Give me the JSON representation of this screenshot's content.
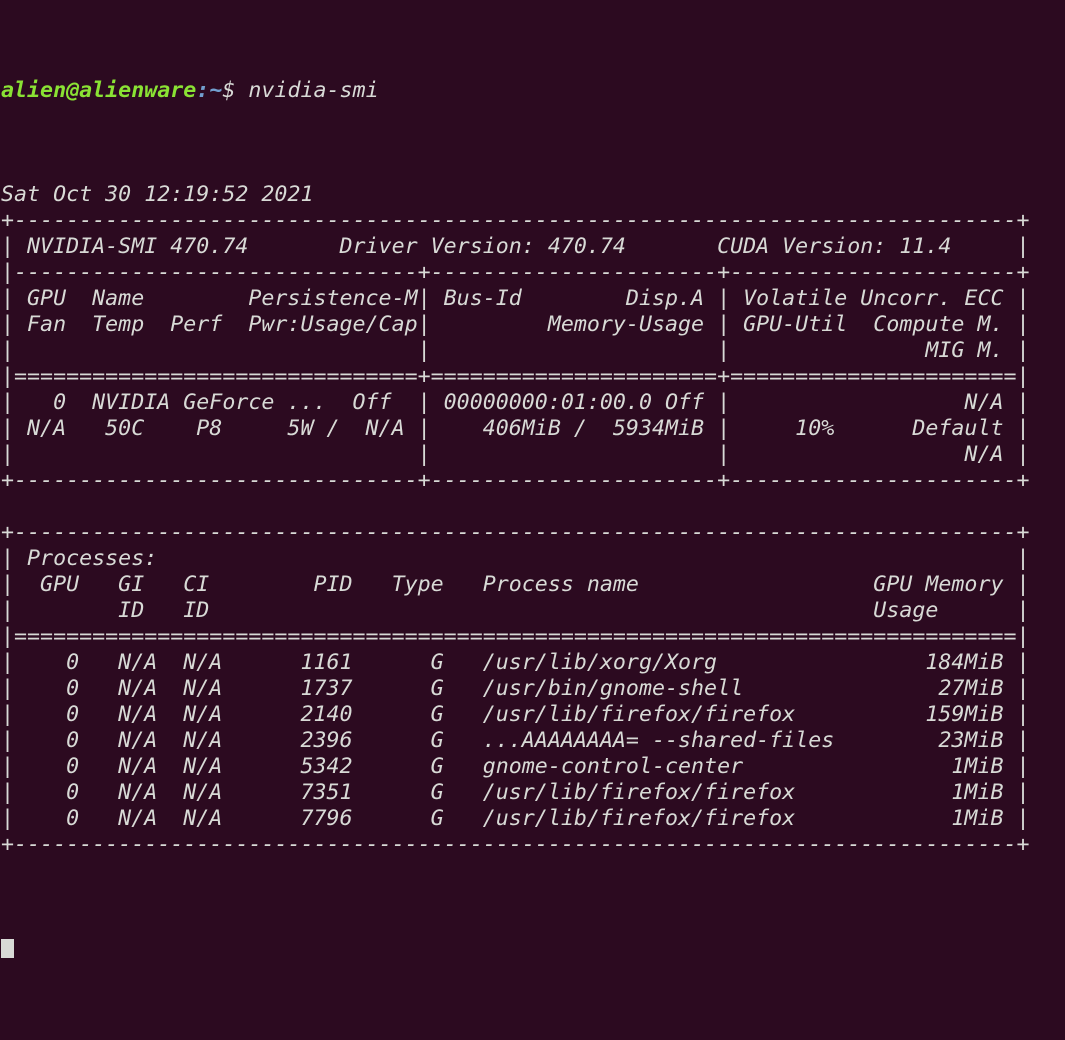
{
  "terminal": {
    "window_title": "alien@alienware: ~",
    "colors": {
      "background": "#2c0a20",
      "foreground": "#d8dad6",
      "prompt_user": "#8ae234",
      "prompt_path": "#729fcf"
    },
    "prompt": {
      "user_host": "alien@alienware",
      "colon": ":",
      "path": "~",
      "dollar": "$ ",
      "command": "nvidia-smi"
    }
  },
  "nvidia_smi": {
    "timestamp": "Sat Oct 30 12:19:52 2021",
    "header": {
      "smi_version_label": "NVIDIA-SMI 470.74",
      "driver_version_label": "Driver Version: 470.74",
      "cuda_version_label": "CUDA Version: 11.4"
    },
    "gpu_table": {
      "columns_row1": [
        "GPU",
        "Name",
        "Persistence-M",
        "Bus-Id",
        "Disp.A",
        "Volatile Uncorr. ECC"
      ],
      "columns_row2": [
        "Fan",
        "Temp",
        "Perf",
        "Pwr:Usage/Cap",
        "Memory-Usage",
        "GPU-Util",
        "Compute M."
      ],
      "columns_row3": [
        "MIG M."
      ],
      "rows": [
        {
          "gpu": "0",
          "name": "NVIDIA GeForce ...",
          "persistence_m": "Off",
          "bus_id": "00000000:01:00.0",
          "disp_a": "Off",
          "ecc": "N/A",
          "fan": "N/A",
          "temp": "50C",
          "perf": "P8",
          "pwr_usage_cap": "5W /  N/A",
          "memory_usage": "406MiB /  5934MiB",
          "gpu_util": "10%",
          "compute_m": "Default",
          "mig_m": "N/A"
        }
      ]
    },
    "processes_table": {
      "section_label": "Processes:",
      "columns_row1": [
        "GPU",
        "GI",
        "CI",
        "PID",
        "Type",
        "Process name",
        "GPU Memory"
      ],
      "columns_row2": [
        "ID",
        "ID",
        "Usage"
      ],
      "rows": [
        {
          "gpu": "0",
          "gi_id": "N/A",
          "ci_id": "N/A",
          "pid": "1161",
          "type": "G",
          "process_name": "/usr/lib/xorg/Xorg",
          "gpu_memory_usage": "184MiB"
        },
        {
          "gpu": "0",
          "gi_id": "N/A",
          "ci_id": "N/A",
          "pid": "1737",
          "type": "G",
          "process_name": "/usr/bin/gnome-shell",
          "gpu_memory_usage": "27MiB"
        },
        {
          "gpu": "0",
          "gi_id": "N/A",
          "ci_id": "N/A",
          "pid": "2140",
          "type": "G",
          "process_name": "/usr/lib/firefox/firefox",
          "gpu_memory_usage": "159MiB"
        },
        {
          "gpu": "0",
          "gi_id": "N/A",
          "ci_id": "N/A",
          "pid": "2396",
          "type": "G",
          "process_name": "...AAAAAAAA= --shared-files",
          "gpu_memory_usage": "23MiB"
        },
        {
          "gpu": "0",
          "gi_id": "N/A",
          "ci_id": "N/A",
          "pid": "5342",
          "type": "G",
          "process_name": "gnome-control-center",
          "gpu_memory_usage": "1MiB"
        },
        {
          "gpu": "0",
          "gi_id": "N/A",
          "ci_id": "N/A",
          "pid": "7351",
          "type": "G",
          "process_name": "/usr/lib/firefox/firefox",
          "gpu_memory_usage": "1MiB"
        },
        {
          "gpu": "0",
          "gi_id": "N/A",
          "ci_id": "N/A",
          "pid": "7796",
          "type": "G",
          "process_name": "/usr/lib/firefox/firefox",
          "gpu_memory_usage": "1MiB"
        }
      ]
    }
  },
  "raw_lines": [
    "",
    "Sat Oct 30 12:19:52 2021       ",
    "+-----------------------------------------------------------------------------+",
    "| NVIDIA-SMI 470.74       Driver Version: 470.74       CUDA Version: 11.4     |",
    "|-------------------------------+----------------------+----------------------+",
    "| GPU  Name        Persistence-M| Bus-Id        Disp.A | Volatile Uncorr. ECC |",
    "| Fan  Temp  Perf  Pwr:Usage/Cap|         Memory-Usage | GPU-Util  Compute M. |",
    "|                               |                      |               MIG M. |",
    "|===============================+======================+======================|",
    "|   0  NVIDIA GeForce ...  Off  | 00000000:01:00.0 Off |                  N/A |",
    "| N/A   50C    P8     5W /  N/A |    406MiB /  5934MiB |     10%      Default |",
    "|                               |                      |                  N/A |",
    "+-------------------------------+----------------------+----------------------+",
    "                                                                               ",
    "+-----------------------------------------------------------------------------+",
    "| Processes:                                                                  |",
    "|  GPU   GI   CI        PID   Type   Process name                  GPU Memory |",
    "|        ID   ID                                                   Usage      |",
    "|=============================================================================|",
    "|    0   N/A  N/A      1161      G   /usr/lib/xorg/Xorg                184MiB |",
    "|    0   N/A  N/A      1737      G   /usr/bin/gnome-shell               27MiB |",
    "|    0   N/A  N/A      2140      G   /usr/lib/firefox/firefox          159MiB |",
    "|    0   N/A  N/A      2396      G   ...AAAAAAAA= --shared-files        23MiB |",
    "|    0   N/A  N/A      5342      G   gnome-control-center                1MiB |",
    "|    0   N/A  N/A      7351      G   /usr/lib/firefox/firefox            1MiB |",
    "|    0   N/A  N/A      7796      G   /usr/lib/firefox/firefox            1MiB |",
    "+-----------------------------------------------------------------------------+"
  ]
}
